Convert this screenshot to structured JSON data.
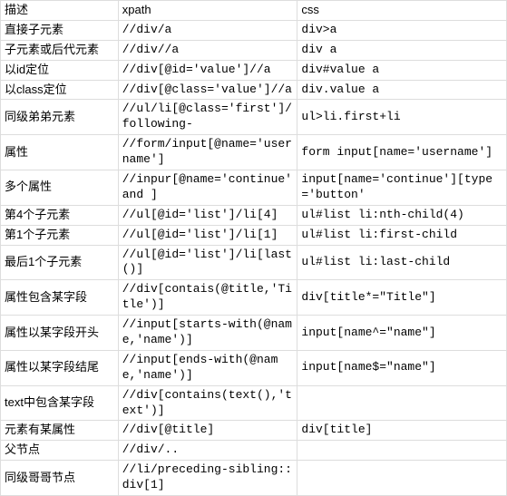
{
  "headers": {
    "c0": "描述",
    "c1": "xpath",
    "c2": "css"
  },
  "rows": [
    {
      "desc": "直接子元素",
      "xpath": "//div/a",
      "css": "div>a"
    },
    {
      "desc": "子元素或后代元素",
      "xpath": "//div//a",
      "css": "div a"
    },
    {
      "desc": "以id定位",
      "xpath": "//div[@id='value']//a",
      "css": "div#value a"
    },
    {
      "desc": "以class定位",
      "xpath": "//div[@class='value']//a",
      "css": "div.value a"
    },
    {
      "desc": "同级弟弟元素",
      "xpath": "//ul/li[@class='first']/following-",
      "css": "ul>li.first+li"
    },
    {
      "desc": "属性",
      "xpath": "//form/input[@name='user name']",
      "css": "form input[name='username']"
    },
    {
      "desc": "多个属性",
      "xpath": "//inpur[@name='continue' and ]",
      "css": "input[name='continue'][type='button'"
    },
    {
      "desc": "第4个子元素",
      "xpath": "//ul[@id='list']/li[4]",
      "css": "ul#list li:nth-child(4)"
    },
    {
      "desc": "第1个子元素",
      "xpath": "//ul[@id='list']/li[1]",
      "css": "ul#list li:first-child"
    },
    {
      "desc": "最后1个子元素",
      "xpath": "//ul[@id='list']/li[last()]",
      "css": "ul#list li:last-child"
    },
    {
      "desc": "属性包含某字段",
      "xpath": "//div[contais(@title,'Title')]",
      "css": "div[title*=\"Title\"]"
    },
    {
      "desc": "属性以某字段开头",
      "xpath": "//input[starts-with(@name,'name')]",
      "css": "input[name^=\"name\"]"
    },
    {
      "desc": "属性以某字段结尾",
      "xpath": "//input[ends-with(@name,'name')]",
      "css": "input[name$=\"name\"]"
    },
    {
      "desc": "text中包含某字段",
      "xpath": "//div[contains(text(),'text')]",
      "css": ""
    },
    {
      "desc": "元素有某属性",
      "xpath": "//div[@title]",
      "css": "div[title]"
    },
    {
      "desc": "父节点",
      "xpath": "//div/..",
      "css": ""
    },
    {
      "desc": "同级哥哥节点",
      "xpath": "//li/preceding-sibling::div[1]",
      "css": ""
    }
  ]
}
